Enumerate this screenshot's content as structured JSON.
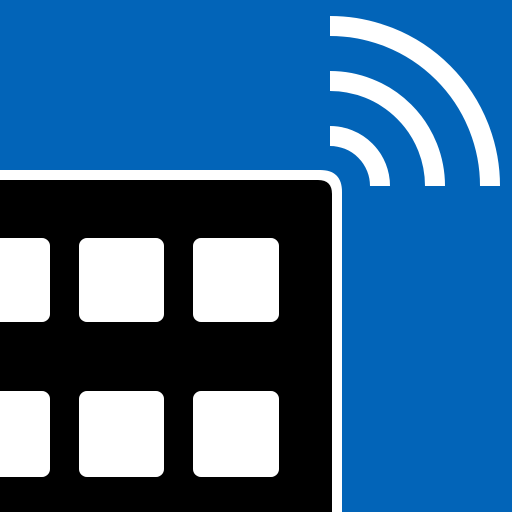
{
  "icon": {
    "name": "wireless-keypad-app-icon",
    "background_color": "#0264b8",
    "keypad_color": "#000000",
    "key_color": "#ffffff",
    "signal_color": "#ffffff",
    "outline_color": "#ffffff",
    "visible_keys": 6,
    "signal_arcs": 3
  }
}
